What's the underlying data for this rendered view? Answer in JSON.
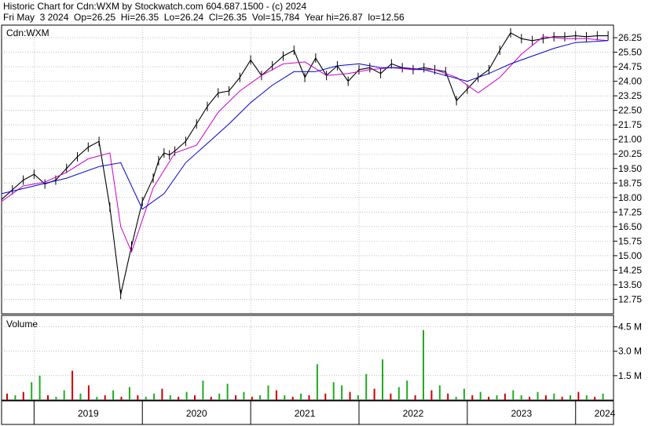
{
  "header": {
    "line1": "Historic Chart for Cdn:WXM by Stockwatch.com 604.687.1500 - (c) 2024",
    "line2": "Fri May  3 2024  Op=26.25  Hi=26.35  Lo=26.24  Cl=26.35  Vol=15,784  Year hi=26.87  lo=12.56"
  },
  "colors": {
    "price": "#000000",
    "ma_short": "#cc00cc",
    "ma_long": "#0000cc",
    "vol_up": "#22aa22",
    "vol_down": "#cc0000",
    "grid": "#999999"
  },
  "chart_data": [
    {
      "type": "line",
      "title": "Cdn:WXM",
      "ylabel": "",
      "ylim": [
        12.0,
        26.9
      ],
      "y_ticks": [
        "26.25",
        "25.50",
        "24.75",
        "24.00",
        "23.25",
        "22.50",
        "21.75",
        "21.00",
        "20.25",
        "19.50",
        "18.75",
        "18.00",
        "17.25",
        "16.50",
        "15.75",
        "15.00",
        "14.25",
        "13.50",
        "12.75"
      ],
      "x_ticks": [
        "2019",
        "2020",
        "2021",
        "2022",
        "2023",
        "2024"
      ],
      "grid": true,
      "series": [
        {
          "key": "price",
          "x": [
            2018.7,
            2018.8,
            2018.9,
            2019.0,
            2019.1,
            2019.2,
            2019.3,
            2019.4,
            2019.5,
            2019.6,
            2019.7,
            2019.8,
            2019.9,
            2020.0,
            2020.1,
            2020.15,
            2020.2,
            2020.25,
            2020.3,
            2020.4,
            2020.5,
            2020.6,
            2020.7,
            2020.8,
            2020.9,
            2021.0,
            2021.1,
            2021.2,
            2021.3,
            2021.4,
            2021.5,
            2021.6,
            2021.7,
            2021.8,
            2021.9,
            2022.0,
            2022.1,
            2022.2,
            2022.3,
            2022.4,
            2022.5,
            2022.6,
            2022.7,
            2022.8,
            2022.9,
            2023.0,
            2023.1,
            2023.2,
            2023.3,
            2023.4,
            2023.5,
            2023.6,
            2023.7,
            2023.8,
            2023.9,
            2024.0,
            2024.1,
            2024.2,
            2024.3
          ],
          "values": [
            17.9,
            18.4,
            18.9,
            19.2,
            18.7,
            18.9,
            19.5,
            20.1,
            20.6,
            20.9,
            17.5,
            13.0,
            15.5,
            17.8,
            19.0,
            19.9,
            20.3,
            20.2,
            20.4,
            20.9,
            21.8,
            22.7,
            23.4,
            23.5,
            24.2,
            25.1,
            24.3,
            24.8,
            25.3,
            25.6,
            24.2,
            25.2,
            24.3,
            24.8,
            24.0,
            24.6,
            24.7,
            24.4,
            24.9,
            24.7,
            24.6,
            24.7,
            24.6,
            24.5,
            23.0,
            23.6,
            24.2,
            24.6,
            25.6,
            26.5,
            26.2,
            26.1,
            26.2,
            26.3,
            26.3,
            26.35,
            26.3,
            26.35,
            26.35
          ]
        },
        {
          "key": "ma_short",
          "x": [
            2018.7,
            2018.9,
            2019.1,
            2019.3,
            2019.5,
            2019.7,
            2019.8,
            2019.9,
            2020.1,
            2020.3,
            2020.5,
            2020.7,
            2020.9,
            2021.1,
            2021.3,
            2021.5,
            2021.7,
            2021.9,
            2022.1,
            2022.3,
            2022.5,
            2022.7,
            2022.9,
            2023.1,
            2023.3,
            2023.5,
            2023.7,
            2023.9,
            2024.1,
            2024.3
          ],
          "values": [
            17.8,
            18.6,
            18.8,
            19.3,
            20.0,
            20.3,
            16.5,
            15.2,
            18.5,
            20.3,
            20.7,
            22.4,
            23.5,
            24.3,
            24.9,
            25.0,
            24.3,
            24.4,
            24.6,
            24.7,
            24.6,
            24.6,
            24.2,
            23.4,
            24.2,
            25.4,
            26.3,
            26.2,
            26.2,
            26.1
          ]
        },
        {
          "key": "ma_long",
          "x": [
            2018.7,
            2019.0,
            2019.3,
            2019.6,
            2019.8,
            2020.0,
            2020.2,
            2020.4,
            2020.6,
            2020.8,
            2021.0,
            2021.2,
            2021.4,
            2021.6,
            2021.8,
            2022.0,
            2022.2,
            2022.4,
            2022.6,
            2022.8,
            2023.0,
            2023.2,
            2023.4,
            2023.6,
            2023.8,
            2024.0,
            2024.3
          ],
          "values": [
            18.2,
            18.6,
            19.0,
            19.6,
            19.8,
            17.4,
            18.2,
            19.8,
            20.8,
            21.8,
            22.9,
            23.8,
            24.5,
            24.5,
            24.8,
            24.9,
            24.7,
            24.7,
            24.6,
            24.3,
            24.0,
            24.4,
            24.9,
            25.3,
            25.7,
            26.0,
            26.1
          ]
        }
      ]
    },
    {
      "type": "bar",
      "title": "Volume",
      "y_ticks": [
        "4.5 M",
        "3.0 M",
        "1.5 M"
      ],
      "x_ticks": [
        "2019",
        "2020",
        "2021",
        "2022",
        "2023",
        "2024"
      ],
      "ylim": [
        0,
        5.2
      ],
      "values_m": [
        0.4,
        0.3,
        0.5,
        1.1,
        1.5,
        0.3,
        0.2,
        0.6,
        1.8,
        0.4,
        0.9,
        0.2,
        0.3,
        0.6,
        0.2,
        0.8,
        0.3,
        0.2,
        0.4,
        0.7,
        0.3,
        0.2,
        0.5,
        0.3,
        1.2,
        0.2,
        0.4,
        1.0,
        0.3,
        0.5,
        0.2,
        0.3,
        0.9,
        0.6,
        0.3,
        0.2,
        0.4,
        0.3,
        2.2,
        0.4,
        1.1,
        0.9,
        0.5,
        0.3,
        1.6,
        0.7,
        2.5,
        0.4,
        0.8,
        1.2,
        0.3,
        4.3,
        0.6,
        0.9,
        0.4,
        0.2,
        0.7,
        0.3,
        0.5,
        0.2,
        0.3,
        0.4,
        0.6,
        0.3,
        0.2,
        0.5,
        0.3,
        0.4,
        0.2,
        0.3,
        0.5,
        0.3,
        0.2,
        0.4
      ],
      "up": [
        0,
        1,
        0,
        1,
        1,
        0,
        1,
        1,
        0,
        1,
        0,
        1,
        0,
        1,
        0,
        1,
        0,
        1,
        1,
        0,
        1,
        0,
        1,
        0,
        1,
        0,
        1,
        1,
        0,
        1,
        0,
        1,
        1,
        0,
        1,
        0,
        1,
        0,
        1,
        0,
        1,
        1,
        0,
        1,
        1,
        0,
        1,
        0,
        1,
        1,
        0,
        1,
        0,
        1,
        0,
        1,
        1,
        0,
        1,
        0,
        1,
        0,
        1,
        1,
        0,
        1,
        0,
        1,
        0,
        1,
        0,
        1,
        0,
        1
      ]
    }
  ]
}
